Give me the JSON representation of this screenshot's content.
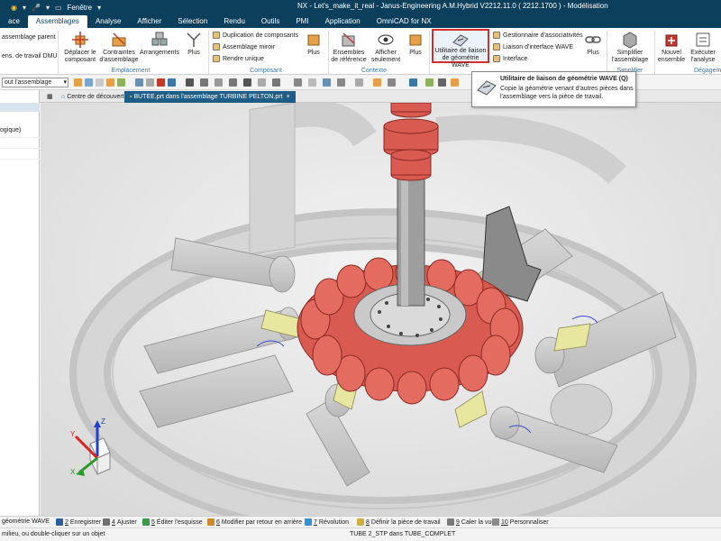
{
  "titlebar": {
    "window_menu": "Fenêtre",
    "title": "NX - Let's_make_it_real - Janus-Engineering A.M.Hybrid V2212.11.0 ( 2212.1700 ) - Modélisation"
  },
  "menubar": {
    "tabs": [
      "ace",
      "Assemblages",
      "Analyse",
      "Afficher",
      "Sélection",
      "Rendu",
      "Outils",
      "PMI",
      "Application",
      "OmniCAD for NX"
    ],
    "active": "Assemblages"
  },
  "ribbon": {
    "left_items": [
      "assemblage parent",
      "ens. de travail DMU"
    ],
    "deplacer": "Déplacer le composant",
    "contraintes": "Contraintes d'assemblage",
    "arrangements": "Arrangements",
    "plus1": "Plus",
    "group_emplacement": "Emplacement",
    "duplication": "Duplication de composants",
    "miroir": "Assemblage miroir",
    "unique": "Rendre unique",
    "group_composant": "Composant",
    "plus2": "Plus",
    "ensembles": "Ensembles de référence",
    "afficher": "Afficher seulement",
    "plus3": "Plus",
    "group_contexte": "Contexte",
    "wave_btn": "Utilitaire de liaison de géométrie WAVE",
    "gestionnaire": "Gestionnaire d'associativités",
    "liaison": "Liaison d'interface WAVE",
    "interface": "Interface",
    "plus4": "Plus",
    "simplifier": "Simplifier l'assemblage",
    "group_simplifier": "Simplifier",
    "nouvel": "Nouvel ensemble",
    "executer": "Exécuter l'analyse",
    "group_degagement": "Dégagem"
  },
  "tooltip": {
    "title": "Utilitaire de liaison de géométrie WAVE (Q)",
    "desc": "Copie la géométrie venant d'autres pièces dans l'assemblage vers la pièce de travail."
  },
  "toolbar": {
    "filter_value": "out l'assemblage"
  },
  "doctabs": {
    "tab1": "Centre de découverte",
    "tab2": "BUTEE.prt dans l'assemblage TURBINE PELTON.prt"
  },
  "leftpanel": {
    "row_logique": "ogique)"
  },
  "commands": [
    {
      "label": "géométrie WAVE",
      "color": "#3b7fbf"
    },
    {
      "key": "2",
      "label": "Enregistrer",
      "color": "#2a5f9e"
    },
    {
      "key": "4",
      "label": "Ajuster",
      "color": "#6f6f6f"
    },
    {
      "key": "5",
      "label": "Éditer l'esquisse",
      "color": "#3a9a4a"
    },
    {
      "key": "6",
      "label": "Modifier par retour en arrière",
      "color": "#d08a2a"
    },
    {
      "key": "7",
      "label": "Révolution",
      "color": "#3b8fd0"
    },
    {
      "key": "8",
      "label": "Définir la pièce de travail",
      "color": "#d0b040"
    },
    {
      "key": "9",
      "label": "Caler la vue",
      "color": "#7a7a7a"
    },
    {
      "key": "10",
      "label": "Personnaliser",
      "color": "#8a8a8a"
    }
  ],
  "status": {
    "left": "milieu, ou double-cliquer sur un objet",
    "right": "TUBE 2_STP dans TUBE_COMPLET"
  },
  "triad": {
    "z": "Z",
    "y": "Y",
    "x": "X"
  },
  "colors": {
    "title_bg": "#0b3f5c",
    "accent": "#1d5d86",
    "highlight": "#d32f2f",
    "part_red": "#d85a50",
    "part_gray": "#c9c9c9",
    "part_yellow": "#e7e7a0"
  }
}
